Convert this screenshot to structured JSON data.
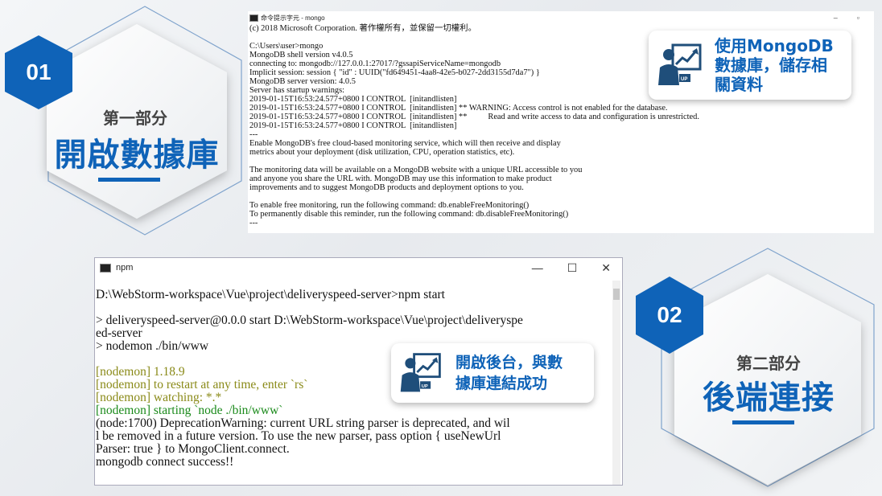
{
  "section1": {
    "number": "01",
    "label": "第一部分",
    "title": "開啟數據庫"
  },
  "section2": {
    "number": "02",
    "label": "第二部分",
    "title": "後端連接"
  },
  "mongo_window": {
    "title": "命令提示字元 - mongo",
    "lines": [
      "(c) 2018 Microsoft Corporation. 著作權所有，並保留一切權利。",
      "",
      "C:\\Users\\user>mongo",
      "MongoDB shell version v4.0.5",
      "connecting to: mongodb://127.0.0.1:27017/?gssapiServiceName=mongodb",
      "Implicit session: session { \"id\" : UUID(\"fd649451-4aa8-42e5-b027-2dd3155d7da7\") }",
      "MongoDB server version: 4.0.5",
      "Server has startup warnings:",
      "2019-01-15T16:53:24.577+0800 I CONTROL  [initandlisten]",
      "2019-01-15T16:53:24.577+0800 I CONTROL  [initandlisten] ** WARNING: Access control is not enabled for the database.",
      "2019-01-15T16:53:24.577+0800 I CONTROL  [initandlisten] **          Read and write access to data and configuration is unrestricted.",
      "2019-01-15T16:53:24.577+0800 I CONTROL  [initandlisten]",
      "---",
      "Enable MongoDB's free cloud-based monitoring service, which will then receive and display",
      "metrics about your deployment (disk utilization, CPU, operation statistics, etc).",
      "",
      "The monitoring data will be available on a MongoDB website with a unique URL accessible to you",
      "and anyone you share the URL with. MongoDB may use this information to make product",
      "improvements and to suggest MongoDB products and deployment options to you.",
      "",
      "To enable free monitoring, run the following command: db.enableFreeMonitoring()",
      "To permanently disable this reminder, run the following command: db.disableFreeMonitoring()",
      "---"
    ]
  },
  "npm_window": {
    "title": "npm",
    "lines": [
      {
        "text": "D:\\WebStorm-workspace\\Vue\\project\\deliveryspeed-server>npm start",
        "style": ""
      },
      {
        "text": "",
        "style": ""
      },
      {
        "text": "> deliveryspeed-server@0.0.0 start D:\\WebStorm-workspace\\Vue\\project\\deliveryspe",
        "style": ""
      },
      {
        "text": "ed-server",
        "style": ""
      },
      {
        "text": "> nodemon ./bin/www",
        "style": ""
      },
      {
        "text": "",
        "style": ""
      },
      {
        "text": "[nodemon] 1.18.9",
        "style": "yel"
      },
      {
        "text": "[nodemon] to restart at any time, enter `rs`",
        "style": "yel"
      },
      {
        "text": "[nodemon] watching: *.*",
        "style": "yel"
      },
      {
        "text": "[nodemon] starting `node ./bin/www`",
        "style": "grn"
      },
      {
        "text": "(node:1700) DeprecationWarning: current URL string parser is deprecated, and wil",
        "style": ""
      },
      {
        "text": "l be removed in a future version. To use the new parser, pass option { useNewUrl",
        "style": ""
      },
      {
        "text": "Parser: true } to MongoClient.connect.",
        "style": ""
      },
      {
        "text": "mongodb connect success!!",
        "style": ""
      }
    ]
  },
  "callout1": {
    "line1": "使用MongoDB",
    "line2": "數據庫，儲存相",
    "line3": "關資料",
    "icon": "businessman-chart-up-icon"
  },
  "callout2": {
    "line1": "開啟後台，與數",
    "line2": "據庫連結成功",
    "icon": "businessman-chart-up-icon"
  },
  "colors": {
    "accent": "#0f63b8",
    "nodemon_yellow": "#8a8a18",
    "nodemon_green": "#1a8a1a"
  }
}
